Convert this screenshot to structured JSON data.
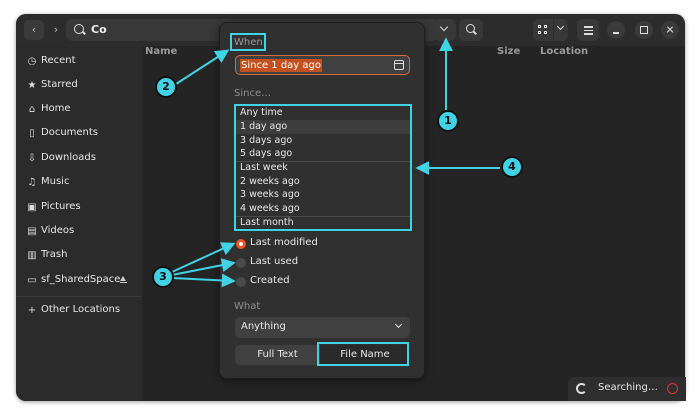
{
  "header": {
    "search_value": "Co",
    "back_icon": "chevron-left-icon",
    "forward_icon": "chevron-right-icon"
  },
  "sidebar": {
    "items": [
      {
        "label": "Recent",
        "icon": "clock-icon"
      },
      {
        "label": "Starred",
        "icon": "star-icon"
      },
      {
        "label": "Home",
        "icon": "home-icon"
      },
      {
        "label": "Documents",
        "icon": "document-icon"
      },
      {
        "label": "Downloads",
        "icon": "download-icon"
      },
      {
        "label": "Music",
        "icon": "music-icon"
      },
      {
        "label": "Pictures",
        "icon": "picture-icon"
      },
      {
        "label": "Videos",
        "icon": "video-icon"
      },
      {
        "label": "Trash",
        "icon": "trash-icon"
      },
      {
        "label": "sf_SharedSpace",
        "icon": "drive-icon"
      },
      {
        "label": "Other Locations",
        "icon": "plus-icon"
      }
    ]
  },
  "columns": {
    "name": "Name",
    "size": "Size",
    "location": "Location"
  },
  "popover": {
    "when_label": "When",
    "date_value": "Since 1 day ago",
    "since_label": "Since…",
    "since_options": [
      "Any time",
      "1 day ago",
      "3 days ago",
      "5 days ago",
      "Last week",
      "2 weeks ago",
      "3 weeks ago",
      "4 weeks ago",
      "Last month"
    ],
    "radios": [
      {
        "label": "Last modified",
        "checked": true
      },
      {
        "label": "Last used",
        "checked": false
      },
      {
        "label": "Created",
        "checked": false
      }
    ],
    "what_label": "What",
    "what_value": "Anything",
    "full_text_label": "Full Text",
    "file_name_label": "File Name"
  },
  "status": {
    "text": "Searching…"
  },
  "callouts": [
    "1",
    "2",
    "3",
    "4"
  ],
  "colors": {
    "accent": "#e95420",
    "callout": "#3fd3e5",
    "window_bg": "#242424",
    "sidebar_bg": "#2b2b2b"
  }
}
